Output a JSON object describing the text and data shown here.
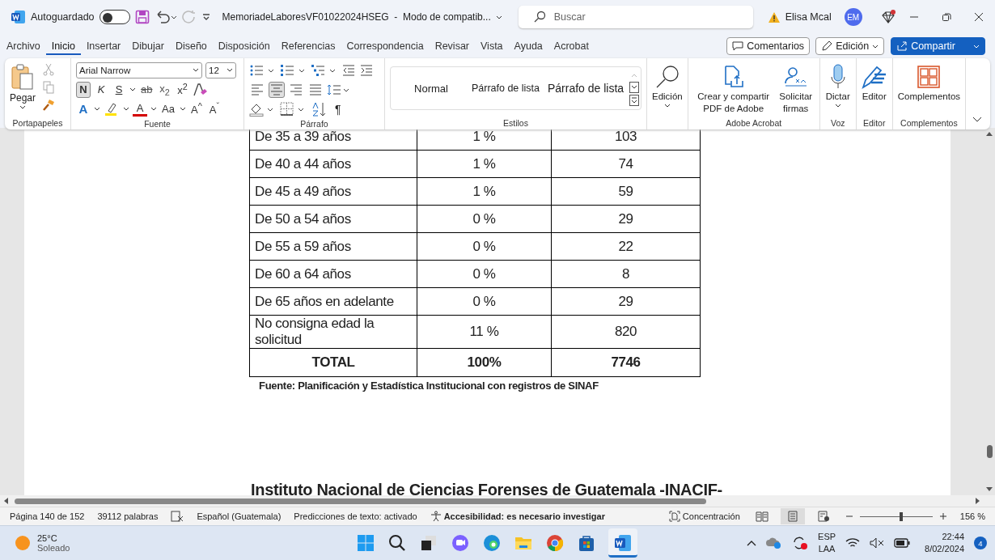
{
  "title_bar": {
    "autosave": {
      "label": "Autoguardado",
      "on": false
    },
    "document_title": "MemoriadeLaboresVF01022024HSEG  -  Modo de compatib...",
    "search": {
      "placeholder": "Buscar"
    },
    "user_name": "Elisa Mcal",
    "avatar_initials": "EM"
  },
  "menu_tabs": [
    {
      "label": "Archivo",
      "selected": false
    },
    {
      "label": "Inicio",
      "selected": true
    },
    {
      "label": "Insertar",
      "selected": false
    },
    {
      "label": "Dibujar",
      "selected": false
    },
    {
      "label": "Diseño",
      "selected": false
    },
    {
      "label": "Disposición",
      "selected": false
    },
    {
      "label": "Referencias",
      "selected": false
    },
    {
      "label": "Correspondencia",
      "selected": false
    },
    {
      "label": "Revisar",
      "selected": false
    },
    {
      "label": "Vista",
      "selected": false
    },
    {
      "label": "Ayuda",
      "selected": false
    },
    {
      "label": "Acrobat",
      "selected": false
    }
  ],
  "header_buttons": {
    "comments": "Comentarios",
    "editing": "Edición",
    "share": "Compartir"
  },
  "ribbon": {
    "paste": "Pegar",
    "font_name": "Arial Narrow",
    "font_size": "12",
    "format_buttons": [
      {
        "label": "N",
        "kind": "bold",
        "selected": true
      },
      {
        "label": "K",
        "kind": "italic",
        "selected": false
      },
      {
        "label": "S",
        "kind": "underline",
        "selected": false
      },
      {
        "label": "ab",
        "kind": "strike",
        "selected": false
      },
      {
        "label": "x$_{2}$",
        "kind": "sub",
        "selected": false
      },
      {
        "label": "x$^{2}$",
        "kind": "super",
        "selected": false
      }
    ],
    "effect_buttons": [
      {
        "label": "A",
        "kind": "effects"
      },
      {
        "label": "A",
        "kind": "color"
      },
      {
        "label": "Aa",
        "kind": "case"
      },
      {
        "label": "A$^{^}$",
        "kind": "grow"
      },
      {
        "label": "A$^{ˇ}$",
        "kind": "shrink"
      }
    ],
    "align_buttons": [
      {
        "kind": "left",
        "selected": false
      },
      {
        "kind": "center",
        "selected": true
      },
      {
        "kind": "right",
        "selected": false
      },
      {
        "kind": "justify",
        "selected": false
      }
    ],
    "pilcrow": "¶",
    "styles": [
      "Normal",
      "Párrafo de lista",
      "Párrafo de lista"
    ],
    "group_labels": [
      "Portapapeles",
      "Fuente",
      "Párrafo",
      "Estilos"
    ],
    "big_groups": [
      {
        "buttons": [
          {
            "label": "Edición",
            "kind": "search"
          }
        ]
      },
      {
        "label": "Adobe Acrobat",
        "buttons": [
          {
            "label": "Crear y compartir PDF de Adobe",
            "kind": "pdf"
          },
          {
            "label": "Solicitar firmas",
            "kind": "sign"
          }
        ]
      },
      {
        "label": "Voz",
        "buttons": [
          {
            "label": "Dictar",
            "kind": "mic"
          }
        ]
      },
      {
        "label": "Editor",
        "buttons": [
          {
            "label": "Editor",
            "kind": "pen"
          }
        ]
      },
      {
        "label": "Complementos",
        "buttons": [
          {
            "label": "Complementos",
            "kind": "grid"
          }
        ]
      }
    ]
  },
  "table": {
    "rows": [
      {
        "age": "De 35 a 39 años",
        "percent": "1 %",
        "count": "103",
        "kind": "data"
      },
      {
        "age": "De 40 a 44 años",
        "percent": "1 %",
        "count": "74",
        "kind": "data"
      },
      {
        "age": "De 45 a 49 años",
        "percent": "1 %",
        "count": "59",
        "kind": "data"
      },
      {
        "age": "De 50 a 54 años",
        "percent": "0 %",
        "count": "29",
        "kind": "data"
      },
      {
        "age": "De 55 a 59 años",
        "percent": "0 %",
        "count": "22",
        "kind": "data"
      },
      {
        "age": "De 60 a 64 años",
        "percent": "0 %",
        "count": "8",
        "kind": "data"
      },
      {
        "age": "De 65 años en adelante",
        "percent": "0 %",
        "count": "29",
        "kind": "data"
      },
      {
        "age": "No consigna edad la solicitud",
        "percent": "11 %",
        "count": "820",
        "kind": "data"
      },
      {
        "age": "TOTAL",
        "percent": "100%",
        "count": "7746",
        "kind": "total"
      }
    ],
    "source": "Fuente: Planificación y Estadística Institucional con registros de SINAF"
  },
  "next_heading": "Instituto Nacional de Ciencias Forenses de Guatemala -INACIF-",
  "status_bar": {
    "page": "Página 140 de 152",
    "words": "39112 palabras",
    "language": "Español (Guatemala)",
    "predictions": "Predicciones de texto: activado",
    "accessibility": "Accesibilidad: es necesario investigar",
    "focus": "Concentración",
    "views": [
      {
        "kind": "read",
        "selected": false
      },
      {
        "kind": "print",
        "selected": true
      },
      {
        "kind": "web",
        "selected": false
      }
    ],
    "zoom": {
      "level": 0.55,
      "reading": "156 %"
    }
  },
  "taskbar": {
    "temperature": "25°C",
    "weather": "Soleado",
    "apps": [
      {
        "kind": "start",
        "selected": false
      },
      {
        "kind": "search",
        "selected": false
      },
      {
        "kind": "taskview",
        "selected": false
      },
      {
        "kind": "chat",
        "selected": false
      },
      {
        "kind": "edge",
        "selected": false
      },
      {
        "kind": "folder",
        "selected": false
      },
      {
        "kind": "chrome",
        "selected": false
      },
      {
        "kind": "store",
        "selected": false
      },
      {
        "kind": "word",
        "selected": true
      }
    ],
    "lang": "ESP",
    "layout": "LAA",
    "time": "22:44",
    "date": "8/02/2024",
    "notifications": "4"
  }
}
